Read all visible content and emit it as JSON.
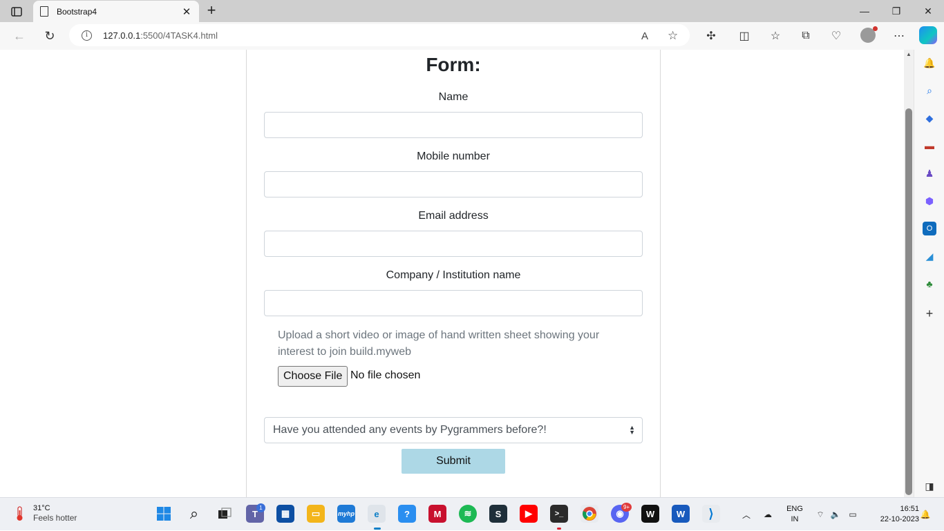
{
  "browser": {
    "tab_title": "Bootstrap4",
    "url_host": "127.0.0.1",
    "url_rest": ":5500/4TASK4.html"
  },
  "form": {
    "title": "Form:",
    "fields": [
      {
        "label": "Name"
      },
      {
        "label": "Mobile number"
      },
      {
        "label": "Email address"
      },
      {
        "label": "Company / Institution name"
      }
    ],
    "upload_help": "Upload a short video or image of hand written sheet showing your interest to join build.myweb",
    "file_button": "Choose File",
    "file_status": "No file chosen",
    "select_value": "Have you attended any events by Pygrammers before?!",
    "submit_label": "Submit"
  },
  "taskbar": {
    "weather_temp": "31°C",
    "weather_desc": "Feels hotter",
    "teams_badge": "1",
    "discord_badge": "9+",
    "lang_line1": "ENG",
    "lang_line2": "IN",
    "time": "16:51",
    "date": "22-10-2023"
  },
  "colors": {
    "submit_bg": "#add8e6",
    "muted_text": "#6c757d",
    "tabbar_bg": "#cfcfcf"
  }
}
